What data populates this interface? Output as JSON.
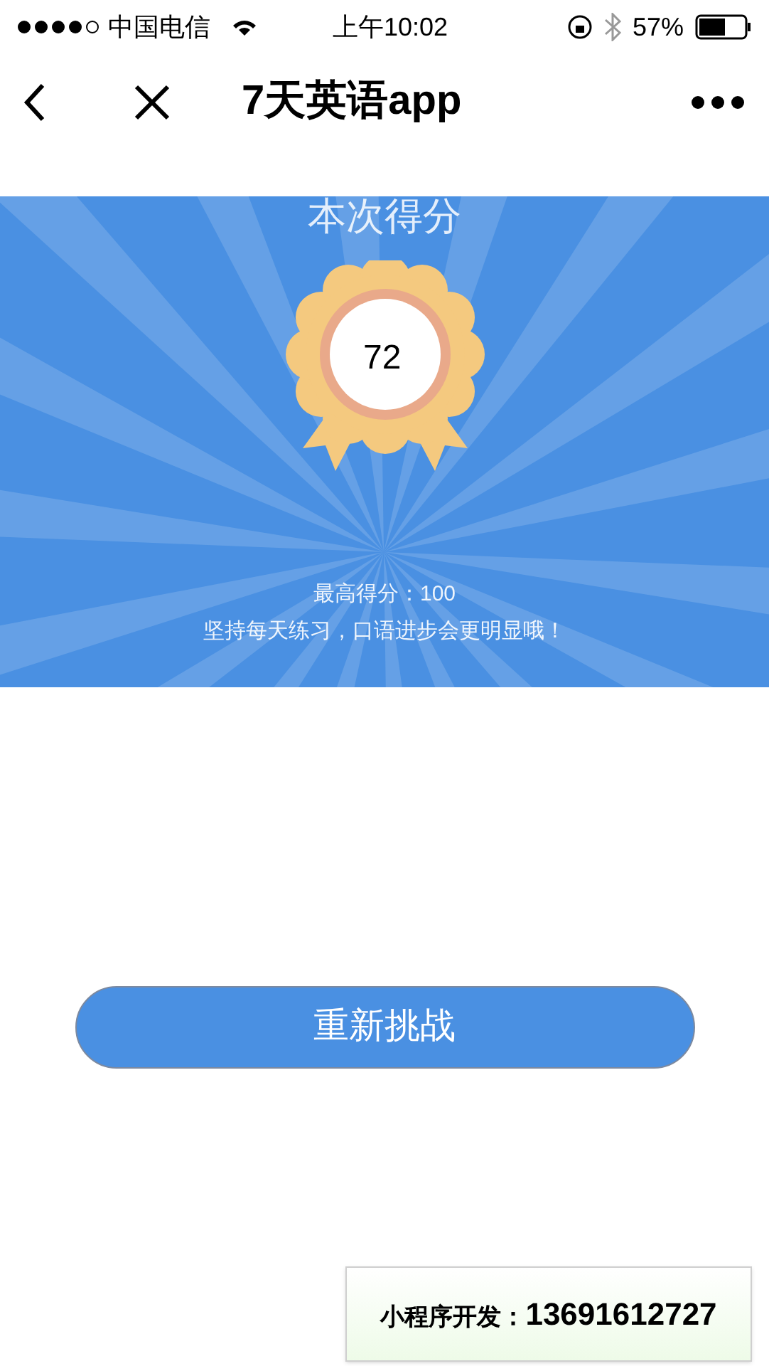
{
  "status_bar": {
    "carrier": "中国电信",
    "time": "上午10:02",
    "battery": "57%"
  },
  "nav": {
    "title": "7天英语app"
  },
  "result": {
    "heading": "本次得分",
    "score": "72",
    "best": "最高得分：100",
    "tip": "坚持每天练习，口语进步会更明显哦！"
  },
  "retry_button": "重新挑战",
  "promo": {
    "label": "小程序开发：",
    "phone": "13691612727"
  }
}
